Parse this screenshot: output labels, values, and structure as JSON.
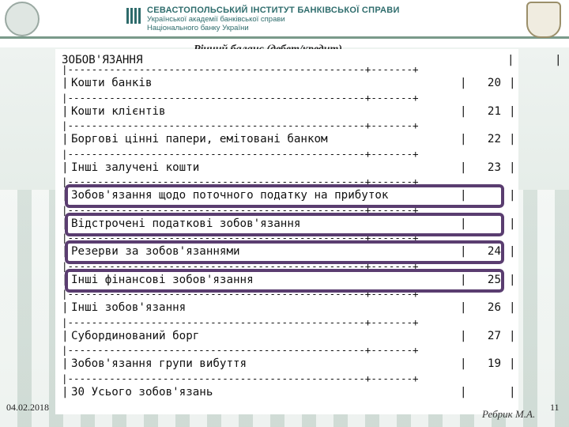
{
  "header": {
    "institute_name": "СЕВАСТОПОЛЬСЬКИЙ ІНСТИТУТ БАНКІВСЬКОЇ СПРАВИ",
    "subtitle_1": "Української академії банківської справи",
    "subtitle_2": "Національного банку України"
  },
  "slide": {
    "title": "Річний баланс (дебет/кредит)"
  },
  "document": {
    "heading": "ЗОБОВ'ЯЗАННЯ",
    "rows": [
      {
        "label": "Кошти банків",
        "note": "20"
      },
      {
        "label": "Кошти клієнтів",
        "note": "21"
      },
      {
        "label": "Боргові цінні папери, емітовані банком",
        "note": "22"
      },
      {
        "label": "Інші залучені кошти",
        "note": "23"
      },
      {
        "label": "Зобов'язання щодо поточного податку на прибуток",
        "note": ""
      },
      {
        "label": "Відстрочені податкові зобов'язання",
        "note": ""
      },
      {
        "label": "Резерви за зобов'язаннями",
        "note": "24"
      },
      {
        "label": "Інші фінансові зобов'язання",
        "note": "25"
      },
      {
        "label": "Інші зобов'язання",
        "note": "26"
      },
      {
        "label": "Субординований борг",
        "note": "27"
      },
      {
        "label": "Зобов'язання групи вибуття",
        "note": "19"
      },
      {
        "label": "30 Усього зобов'язань",
        "note": ""
      }
    ]
  },
  "footer": {
    "date": "04.02.2018",
    "author": "Ребрик М.А.",
    "page": "11"
  },
  "colors": {
    "highlight": "#5a3d70",
    "header_text": "#2f6d6d"
  }
}
